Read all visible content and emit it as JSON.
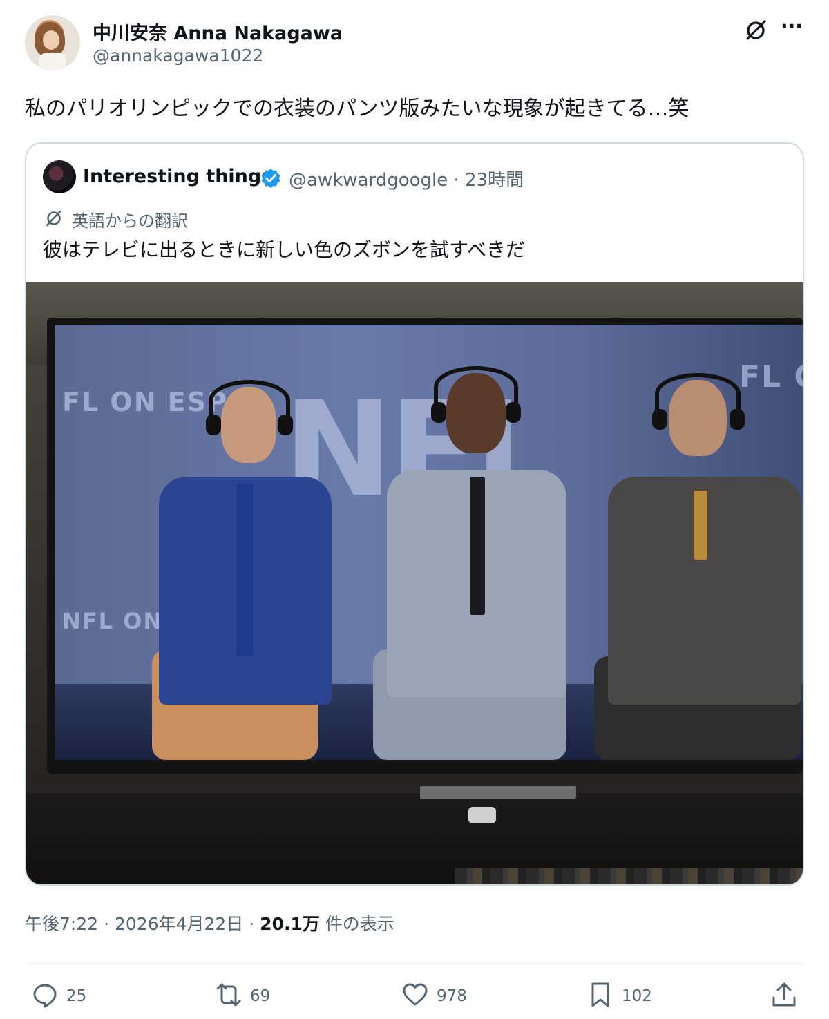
{
  "author": {
    "name": "中川安奈 Anna Nakagawa",
    "handle": "@annakagawa1022"
  },
  "tweet": {
    "text": "私のパリオリンピックでの衣装のパンツ版みたいな現象が起きてる…笑"
  },
  "quoted": {
    "name": "Interesting things",
    "handle_time": "@awkwardgoogle · 23時間",
    "translation_label": "英語からの翻訳",
    "text": "彼はテレビに出るときに新しい色のズボンを試すべきだ",
    "media": {
      "screen_words": [
        "NFL",
        "FL ON ESP",
        "FL O",
        "NFL ON"
      ]
    }
  },
  "meta": {
    "time_date": "午後7:22 · 2026年4月22日 · ",
    "views": "20.1万",
    "views_suffix": " 件の表示"
  },
  "actions": {
    "replies": "25",
    "reposts": "69",
    "likes": "978",
    "bookmarks": "102"
  },
  "colors": {
    "text": "#0f1419",
    "secondary": "#536471",
    "border": "#cfd9de",
    "verified": "#1d9bf0"
  }
}
